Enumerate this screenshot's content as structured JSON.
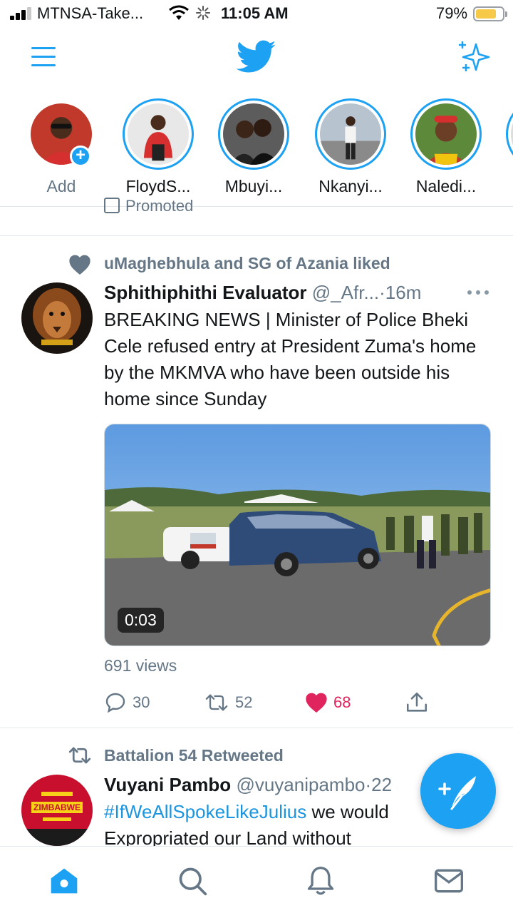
{
  "status_bar": {
    "carrier": "MTNSA-Take...",
    "time": "11:05 AM",
    "battery_percent": "79%",
    "battery_level": 0.79,
    "signal_bars": 3
  },
  "header": {
    "menu_icon": "hamburger-icon",
    "logo_icon": "twitter-bird-icon",
    "sparkle_icon": "sparkle-icon"
  },
  "fleets": [
    {
      "name": "Add",
      "own": true
    },
    {
      "name": "FloydS..."
    },
    {
      "name": "Mbuyi..."
    },
    {
      "name": "Nkanyi..."
    },
    {
      "name": "Naledi..."
    }
  ],
  "promoted_label": "Promoted",
  "tweets": [
    {
      "social_context": "uMaghebhula and SG of Azania liked",
      "display_name": "Sphithiphithi Evaluator",
      "handle": "@_Afr...",
      "sep": "·",
      "time": "16m",
      "text": "BREAKING NEWS | Minister of Police Bheki Cele refused entry at President Zuma's home by the MKMVA who have been outside his home since Sunday",
      "video_duration": "0:03",
      "views": "691 views",
      "replies": "30",
      "retweets": "52",
      "likes": "68",
      "liked": true
    },
    {
      "social_context": "Battalion 54 Retweeted",
      "display_name": "Vuyani Pambo",
      "handle": "@vuyanipambo",
      "sep": "·",
      "time": "22",
      "hashtag": "#IfWeAllSpokeLikeJulius",
      "text_after_hashtag": " we would",
      "text_line2": "Expropriated our Land without",
      "avatar_text": "ZIMBABWE"
    }
  ],
  "colors": {
    "brand_blue": "#1da1f2",
    "like_red": "#e0245e",
    "secondary_text": "#657786"
  },
  "compose_button_icon": "compose-feather-icon",
  "tabbar": [
    "home-icon",
    "search-icon",
    "notifications-bell-icon",
    "messages-envelope-icon"
  ]
}
